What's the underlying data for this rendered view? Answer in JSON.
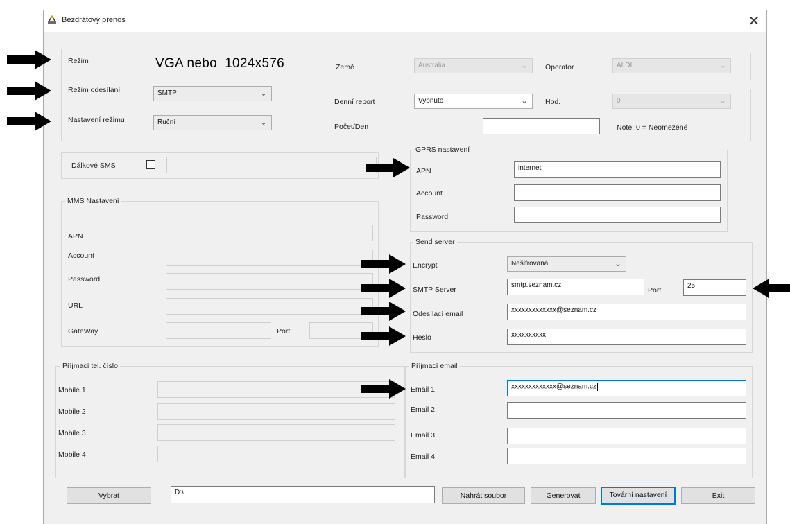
{
  "window": {
    "title": "Bezdrátový přenos",
    "close": "✕"
  },
  "mode": {
    "label": "Režim",
    "value": "VGA nebo  1024x576",
    "send_mode_label": "Režim odesílání",
    "send_mode_value": "SMTP",
    "setting_label": "Nastavení režimu",
    "setting_value": "Ruční"
  },
  "country": {
    "label": "Země",
    "value": "Australia",
    "operator_label": "Operator",
    "operator_value": "ALDI"
  },
  "report": {
    "daily_label": "Denní report",
    "daily_value": "Vypnuto",
    "hour_label": "Hod.",
    "hour_value": "0",
    "count_label": "Počet/Den",
    "count_value": "",
    "note": "Note: 0 = Neomezeně"
  },
  "remote_sms": {
    "label": "Dálkové SMS",
    "value": ""
  },
  "mms": {
    "title": "MMS Nastavení",
    "apn_label": "APN",
    "account_label": "Account",
    "password_label": "Password",
    "url_label": "URL",
    "gateway_label": "GateWay",
    "port_label": "Port"
  },
  "gprs": {
    "title": "GPRS nastavení",
    "apn_label": "APN",
    "apn_value": "internet",
    "account_label": "Account",
    "account_value": "",
    "password_label": "Password",
    "password_value": ""
  },
  "send_server": {
    "title": "Send server",
    "encrypt_label": "Encrypt",
    "encrypt_value": "Nešifrovaná",
    "smtp_label": "SMTP Server",
    "smtp_value": "smtp.seznam.cz",
    "port_label": "Port",
    "port_value": "25",
    "from_label": "Odesílací email",
    "from_value": "xxxxxxxxxxxxx@seznam.cz",
    "pass_label": "Heslo",
    "pass_value": "xxxxxxxxxx"
  },
  "receive_phone": {
    "title": "Příjmací tel. číslo",
    "mobile_1": "Mobile 1",
    "mobile_2": "Mobile 2",
    "mobile_3": "Mobile 3",
    "mobile_4": "Mobile 4"
  },
  "receive_email": {
    "title": "Příjmací email",
    "email_1_label": "Email 1",
    "email_1_value": "xxxxxxxxxxxxx@seznam.cz",
    "email_2_label": "Email 2",
    "email_3_label": "Email 3",
    "email_4_label": "Email 4"
  },
  "bottom": {
    "select_label": "Vybrat",
    "path_value": "D:\\",
    "upload_label": "Nahrát soubor",
    "generate_label": "Generovat",
    "factory_label": "Tovární nastavení",
    "exit_label": "Exit"
  },
  "icons": {
    "arrow": "arrow-icon",
    "dropdown": "chevron-down-icon"
  }
}
